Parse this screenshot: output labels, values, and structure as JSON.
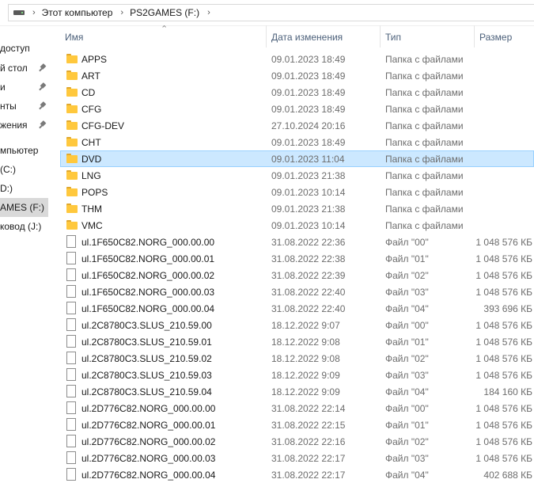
{
  "address": {
    "crumbs": [
      "Этот компьютер",
      "PS2GAMES (F:)"
    ]
  },
  "nav": {
    "items": [
      {
        "label": "доступ",
        "pinned": false
      },
      {
        "label": "й стол",
        "pinned": true
      },
      {
        "label": "и",
        "pinned": true
      },
      {
        "label": "нты",
        "pinned": true
      },
      {
        "label": "жения",
        "pinned": true
      },
      {
        "label": "мпьютер",
        "pinned": false
      },
      {
        "label": "(C:)",
        "pinned": false
      },
      {
        "label": "D:)",
        "pinned": false
      },
      {
        "label": "AMES (F:)",
        "pinned": false,
        "selected": true
      },
      {
        "label": "ковод (J:)",
        "pinned": false
      }
    ]
  },
  "columns": {
    "name": "Имя",
    "date": "Дата изменения",
    "type": "Тип",
    "size": "Размер"
  },
  "rows": [
    {
      "kind": "folder",
      "name": "APPS",
      "date": "09.01.2023 18:49",
      "type": "Папка с файлами",
      "size": ""
    },
    {
      "kind": "folder",
      "name": "ART",
      "date": "09.01.2023 18:49",
      "type": "Папка с файлами",
      "size": ""
    },
    {
      "kind": "folder",
      "name": "CD",
      "date": "09.01.2023 18:49",
      "type": "Папка с файлами",
      "size": ""
    },
    {
      "kind": "folder",
      "name": "CFG",
      "date": "09.01.2023 18:49",
      "type": "Папка с файлами",
      "size": ""
    },
    {
      "kind": "folder",
      "name": "CFG-DEV",
      "date": "27.10.2024 20:16",
      "type": "Папка с файлами",
      "size": ""
    },
    {
      "kind": "folder",
      "name": "CHT",
      "date": "09.01.2023 18:49",
      "type": "Папка с файлами",
      "size": ""
    },
    {
      "kind": "folder",
      "name": "DVD",
      "date": "09.01.2023 11:04",
      "type": "Папка с файлами",
      "size": "",
      "selected": true
    },
    {
      "kind": "folder",
      "name": "LNG",
      "date": "09.01.2023 21:38",
      "type": "Папка с файлами",
      "size": ""
    },
    {
      "kind": "folder",
      "name": "POPS",
      "date": "09.01.2023 10:14",
      "type": "Папка с файлами",
      "size": ""
    },
    {
      "kind": "folder",
      "name": "THM",
      "date": "09.01.2023 21:38",
      "type": "Папка с файлами",
      "size": ""
    },
    {
      "kind": "folder",
      "name": "VMC",
      "date": "09.01.2023 10:14",
      "type": "Папка с файлами",
      "size": ""
    },
    {
      "kind": "file",
      "name": "ul.1F650C82.NORG_000.00.00",
      "date": "31.08.2022 22:36",
      "type": "Файл \"00\"",
      "size": "1 048 576 КБ"
    },
    {
      "kind": "file",
      "name": "ul.1F650C82.NORG_000.00.01",
      "date": "31.08.2022 22:38",
      "type": "Файл \"01\"",
      "size": "1 048 576 КБ"
    },
    {
      "kind": "file",
      "name": "ul.1F650C82.NORG_000.00.02",
      "date": "31.08.2022 22:39",
      "type": "Файл \"02\"",
      "size": "1 048 576 КБ"
    },
    {
      "kind": "file",
      "name": "ul.1F650C82.NORG_000.00.03",
      "date": "31.08.2022 22:40",
      "type": "Файл \"03\"",
      "size": "1 048 576 КБ"
    },
    {
      "kind": "file",
      "name": "ul.1F650C82.NORG_000.00.04",
      "date": "31.08.2022 22:40",
      "type": "Файл \"04\"",
      "size": "393 696 КБ"
    },
    {
      "kind": "file",
      "name": "ul.2C8780C3.SLUS_210.59.00",
      "date": "18.12.2022 9:07",
      "type": "Файл \"00\"",
      "size": "1 048 576 КБ"
    },
    {
      "kind": "file",
      "name": "ul.2C8780C3.SLUS_210.59.01",
      "date": "18.12.2022 9:08",
      "type": "Файл \"01\"",
      "size": "1 048 576 КБ"
    },
    {
      "kind": "file",
      "name": "ul.2C8780C3.SLUS_210.59.02",
      "date": "18.12.2022 9:08",
      "type": "Файл \"02\"",
      "size": "1 048 576 КБ"
    },
    {
      "kind": "file",
      "name": "ul.2C8780C3.SLUS_210.59.03",
      "date": "18.12.2022 9:09",
      "type": "Файл \"03\"",
      "size": "1 048 576 КБ"
    },
    {
      "kind": "file",
      "name": "ul.2C8780C3.SLUS_210.59.04",
      "date": "18.12.2022 9:09",
      "type": "Файл \"04\"",
      "size": "184 160 КБ"
    },
    {
      "kind": "file",
      "name": "ul.2D776C82.NORG_000.00.00",
      "date": "31.08.2022 22:14",
      "type": "Файл \"00\"",
      "size": "1 048 576 КБ"
    },
    {
      "kind": "file",
      "name": "ul.2D776C82.NORG_000.00.01",
      "date": "31.08.2022 22:15",
      "type": "Файл \"01\"",
      "size": "1 048 576 КБ"
    },
    {
      "kind": "file",
      "name": "ul.2D776C82.NORG_000.00.02",
      "date": "31.08.2022 22:16",
      "type": "Файл \"02\"",
      "size": "1 048 576 КБ"
    },
    {
      "kind": "file",
      "name": "ul.2D776C82.NORG_000.00.03",
      "date": "31.08.2022 22:17",
      "type": "Файл \"03\"",
      "size": "1 048 576 КБ"
    },
    {
      "kind": "file",
      "name": "ul.2D776C82.NORG_000.00.04",
      "date": "31.08.2022 22:17",
      "type": "Файл \"04\"",
      "size": "402 688 КБ"
    }
  ]
}
